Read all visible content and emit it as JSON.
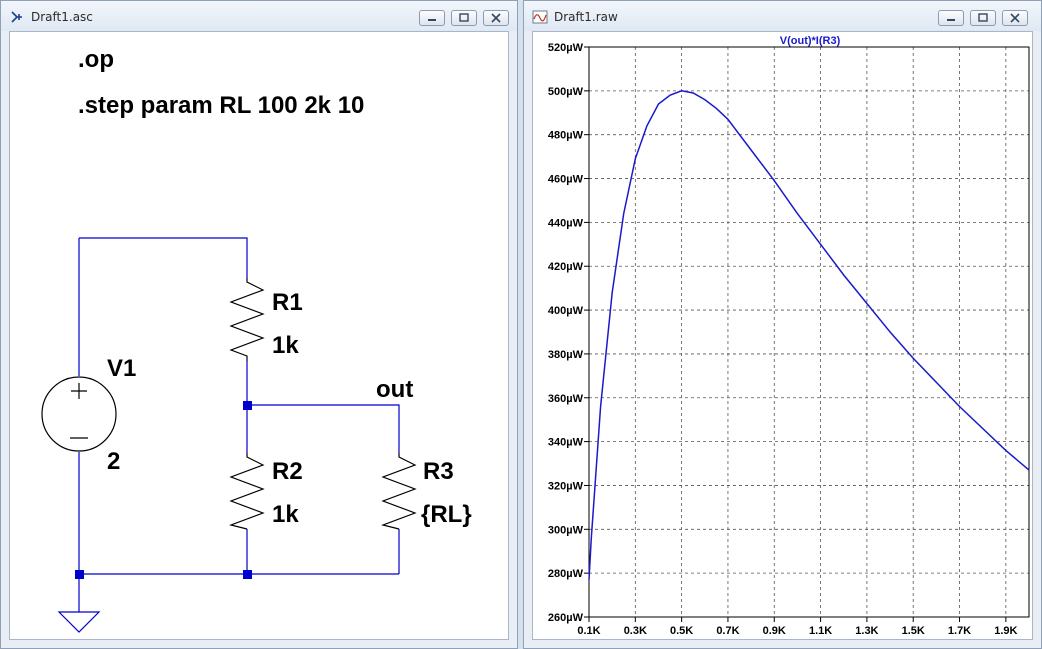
{
  "colors": {
    "wire": "#0000cc",
    "trace": "#1a1acc",
    "title_blue": "#1a1acc"
  },
  "schematic_window": {
    "title": "Draft1.asc",
    "icon": "schematic-icon",
    "buttons": [
      "minimize-icon",
      "restore-icon",
      "close-icon"
    ],
    "directives": [
      ".op",
      ".step param RL 100 2k 10"
    ],
    "components": {
      "V1": {
        "name": "V1",
        "value": "2"
      },
      "R1": {
        "name": "R1",
        "value": "1k"
      },
      "R2": {
        "name": "R2",
        "value": "1k"
      },
      "R3": {
        "name": "R3",
        "value": "{RL}"
      }
    },
    "net_label": "out"
  },
  "waveform_window": {
    "title": "Draft1.raw",
    "icon": "waveform-icon",
    "buttons": [
      "minimize-icon",
      "restore-icon",
      "close-icon"
    ]
  },
  "chart_data": {
    "type": "line",
    "title": "",
    "xlabel": "",
    "ylabel": "",
    "grid": true,
    "xlim": [
      0.1,
      2.0
    ],
    "ylim": [
      260,
      520
    ],
    "x_ticks": [
      "0.1K",
      "0.3K",
      "0.5K",
      "0.7K",
      "0.9K",
      "1.1K",
      "1.3K",
      "1.5K",
      "1.7K",
      "1.9K"
    ],
    "y_ticks": [
      "260µW",
      "280µW",
      "300µW",
      "320µW",
      "340µW",
      "360µW",
      "380µW",
      "400µW",
      "420µW",
      "440µW",
      "460µW",
      "480µW",
      "500µW",
      "520µW"
    ],
    "series": [
      {
        "name": "V(out)*I(R3)",
        "x": [
          0.1,
          0.11,
          0.15,
          0.2,
          0.25,
          0.3,
          0.35,
          0.4,
          0.45,
          0.5,
          0.55,
          0.6,
          0.65,
          0.7,
          0.8,
          0.9,
          1.0,
          1.1,
          1.2,
          1.3,
          1.4,
          1.5,
          1.6,
          1.7,
          1.8,
          1.9,
          2.0
        ],
        "values": [
          277,
          296,
          356,
          408,
          444,
          469,
          484,
          494,
          498,
          500,
          499,
          496,
          492,
          487,
          473,
          459,
          444,
          430,
          416,
          403,
          390,
          378,
          367,
          356,
          346,
          336,
          327
        ]
      }
    ]
  }
}
